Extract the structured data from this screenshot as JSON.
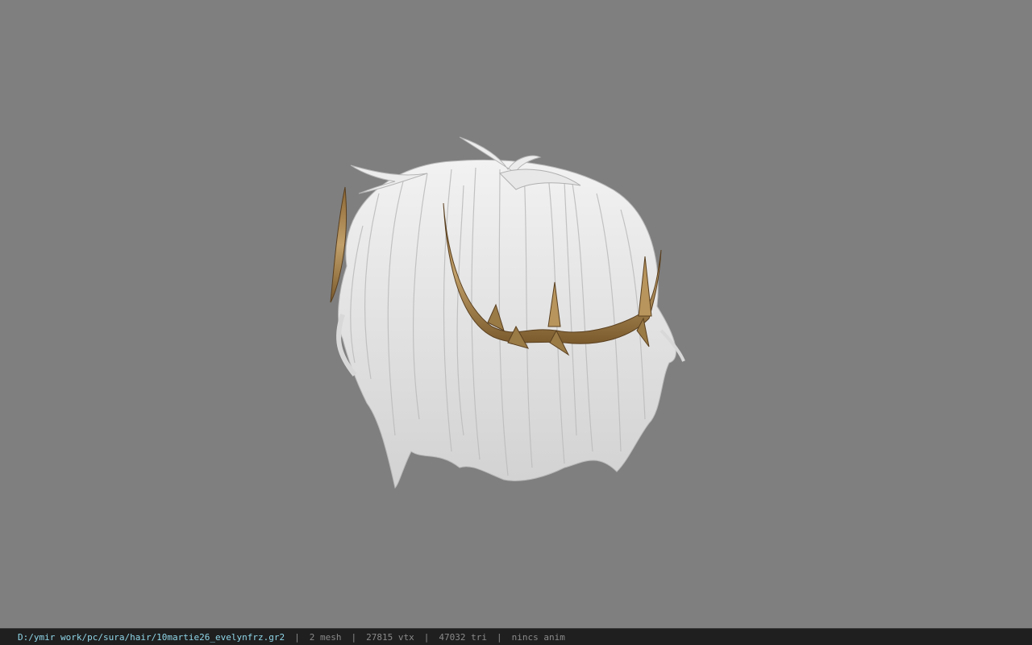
{
  "viewer": {
    "background_color": "#7f7f7f",
    "hair_color": "#e6e6e6",
    "crown_color": "#a07d48"
  },
  "status_bar": {
    "file_path": "D:/ymir work/pc/sura/hair/10martie26_evelynfrz.gr2",
    "separator": "|",
    "mesh_count": "2 mesh",
    "vertex_count": "27815 vtx",
    "triangle_count": "47032 tri",
    "anim_status": "nincs anim"
  }
}
